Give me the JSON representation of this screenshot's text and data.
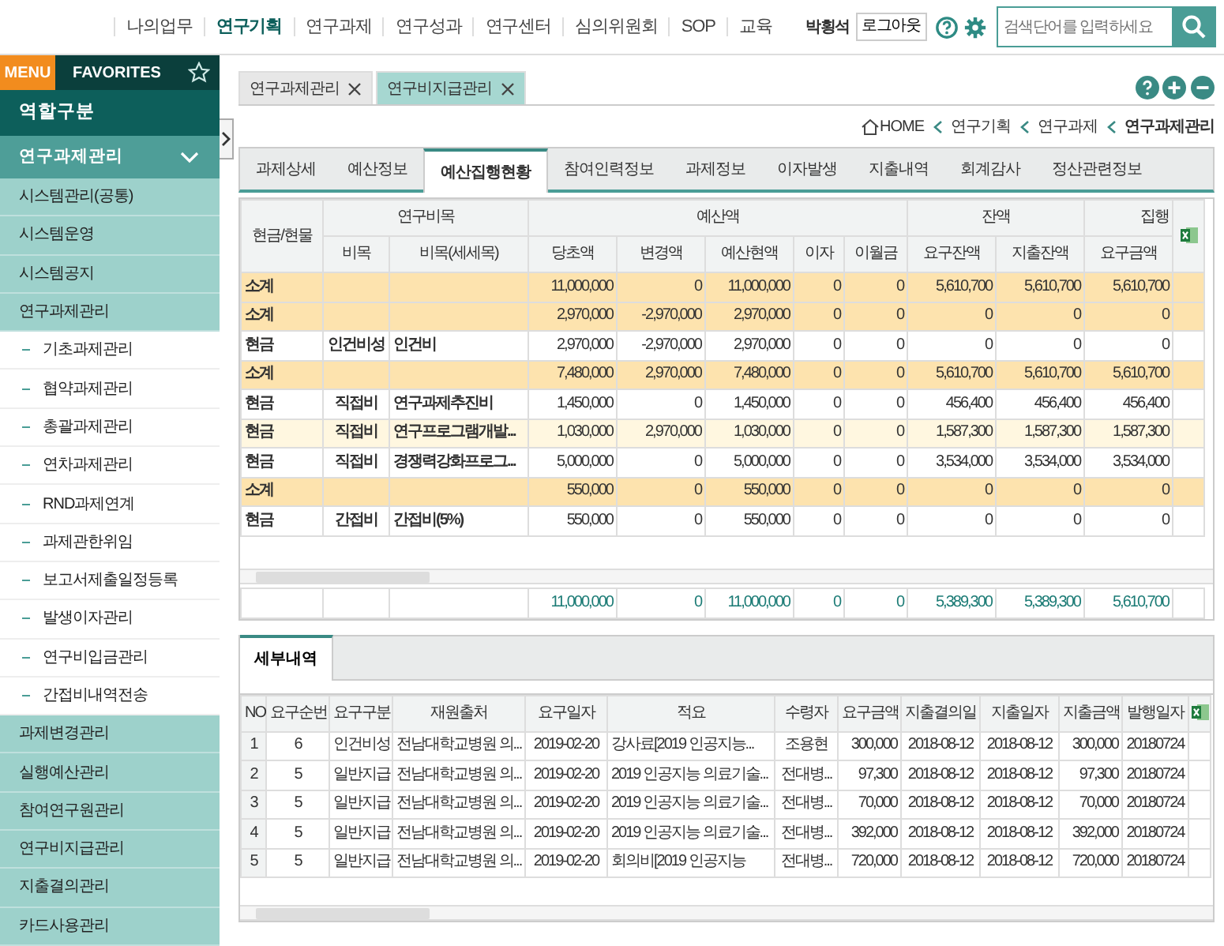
{
  "top_nav": {
    "items": [
      {
        "label": "나의업무",
        "selected": false
      },
      {
        "label": "연구기획",
        "selected": true
      },
      {
        "label": "연구과제",
        "selected": false
      },
      {
        "label": "연구성과",
        "selected": false
      },
      {
        "label": "연구센터",
        "selected": false
      },
      {
        "label": "심의위원회",
        "selected": false
      },
      {
        "label": "SOP",
        "selected": false
      },
      {
        "label": "교육",
        "selected": false
      }
    ],
    "user": "박횡석",
    "logout": "로그아웃",
    "search": {
      "placeholder": "검색단어를 입력하세요"
    }
  },
  "sidebar": {
    "tabs": [
      {
        "label": "MENU",
        "selected": true
      },
      {
        "label": "FAVORITES",
        "selected": false
      }
    ],
    "role": "역할구분",
    "section": {
      "label": "연구과제관리",
      "expanded": true
    },
    "items": [
      {
        "label": "시스템관리(공통)",
        "kind": "group"
      },
      {
        "label": "시스템운영",
        "kind": "group"
      },
      {
        "label": "시스템공지",
        "kind": "group"
      },
      {
        "label": "연구과제관리",
        "kind": "group"
      },
      {
        "label": "기초과제관리",
        "kind": "sub"
      },
      {
        "label": "협약과제관리",
        "kind": "sub"
      },
      {
        "label": "총괄과제관리",
        "kind": "sub"
      },
      {
        "label": "연차과제관리",
        "kind": "sub"
      },
      {
        "label": "RND과제연계",
        "kind": "sub"
      },
      {
        "label": "과제관한위임",
        "kind": "sub"
      },
      {
        "label": "보고서제출일정등록",
        "kind": "sub"
      },
      {
        "label": "발생이자관리",
        "kind": "sub"
      },
      {
        "label": "연구비입금관리",
        "kind": "sub"
      },
      {
        "label": "간접비내역전송",
        "kind": "sub"
      },
      {
        "label": "과제변경관리",
        "kind": "group"
      },
      {
        "label": "실행예산관리",
        "kind": "group"
      },
      {
        "label": "참여연구원관리",
        "kind": "group"
      },
      {
        "label": "연구비지급관리",
        "kind": "group"
      },
      {
        "label": "지출결의관리",
        "kind": "group"
      },
      {
        "label": "카드사용관리",
        "kind": "group"
      }
    ]
  },
  "open_tabs": [
    {
      "label": "연구과제관리",
      "selected": false
    },
    {
      "label": "연구비지급관리",
      "selected": true
    }
  ],
  "breadcrumb": [
    "HOME",
    "연구기획",
    "연구과제",
    "연구과제관리"
  ],
  "detail_tabs": [
    {
      "label": "과제상세",
      "selected": false
    },
    {
      "label": "예산정보",
      "selected": false
    },
    {
      "label": "예산집행현황",
      "selected": true
    },
    {
      "label": "참여인력정보",
      "selected": false
    },
    {
      "label": "과제정보",
      "selected": false
    },
    {
      "label": "이자발생",
      "selected": false
    },
    {
      "label": "지출내역",
      "selected": false
    },
    {
      "label": "회계감사",
      "selected": false
    },
    {
      "label": "정산관련정보",
      "selected": false
    }
  ],
  "budget_table": {
    "first_column": "현금/현물",
    "column_groups": [
      {
        "label": "연구비목",
        "columns": [
          "비목",
          "비목(세세목)"
        ]
      },
      {
        "label": "예산액",
        "columns": [
          "당초액",
          "변경액",
          "예산현액",
          "이자",
          "이월금"
        ]
      },
      {
        "label": "잔액",
        "columns": [
          "요구잔액",
          "지출잔액"
        ]
      },
      {
        "label": "집행",
        "columns": [
          "요구금액"
        ]
      }
    ],
    "rows": [
      {
        "kind": "subtotal",
        "selected": false,
        "cells": [
          "소계",
          "",
          "",
          "11,000,000",
          "0",
          "11,000,000",
          "0",
          "0",
          "5,610,700",
          "5,610,700",
          "5,610,700"
        ]
      },
      {
        "kind": "subtotal",
        "selected": false,
        "cells": [
          "소계",
          "",
          "",
          "2,970,000",
          "-2,970,000",
          "2,970,000",
          "0",
          "0",
          "0",
          "0",
          "0"
        ]
      },
      {
        "kind": "item",
        "selected": false,
        "cells": [
          "현금",
          "인건비성",
          "인건비",
          "2,970,000",
          "-2,970,000",
          "2,970,000",
          "0",
          "0",
          "0",
          "0",
          "0"
        ]
      },
      {
        "kind": "subtotal",
        "selected": false,
        "cells": [
          "소계",
          "",
          "",
          "7,480,000",
          "2,970,000",
          "7,480,000",
          "0",
          "0",
          "5,610,700",
          "5,610,700",
          "5,610,700"
        ]
      },
      {
        "kind": "item",
        "selected": false,
        "cells": [
          "현금",
          "직접비",
          "연구과제추진비",
          "1,450,000",
          "0",
          "1,450,000",
          "0",
          "0",
          "456,400",
          "456,400",
          "456,400"
        ]
      },
      {
        "kind": "item",
        "selected": true,
        "cells": [
          "현금",
          "직접비",
          "연구프로그램개발...",
          "1,030,000",
          "2,970,000",
          "1,030,000",
          "0",
          "0",
          "1,587,300",
          "1,587,300",
          "1,587,300"
        ]
      },
      {
        "kind": "item",
        "selected": false,
        "cells": [
          "현금",
          "직접비",
          "경쟁력강화프로그...",
          "5,000,000",
          "0",
          "5,000,000",
          "0",
          "0",
          "3,534,000",
          "3,534,000",
          "3,534,000"
        ]
      },
      {
        "kind": "subtotal",
        "selected": false,
        "cells": [
          "소계",
          "",
          "",
          "550,000",
          "0",
          "550,000",
          "0",
          "0",
          "0",
          "0",
          "0"
        ]
      },
      {
        "kind": "item",
        "selected": false,
        "cells": [
          "현금",
          "간접비",
          "간접비(5%)",
          "550,000",
          "0",
          "550,000",
          "0",
          "0",
          "0",
          "0",
          "0"
        ]
      }
    ],
    "totals": [
      "11,000,000",
      "0",
      "11,000,000",
      "0",
      "0",
      "5,389,300",
      "5,389,300",
      "5,610,700"
    ]
  },
  "detail_section": {
    "tab": "세부내역",
    "columns": [
      "NO",
      "요구순번",
      "요구구분",
      "재원출처",
      "요구일자",
      "적요",
      "수령자",
      "요구금액",
      "지출결의일",
      "지출일자",
      "지출금액",
      "발행일자"
    ],
    "rows": [
      [
        "1",
        "6",
        "인건비성",
        "전남대학교병원 의...",
        "2019-02-20",
        "강사료[2019 인공지능...",
        "조용현",
        "300,000",
        "2018-08-12",
        "2018-08-12",
        "300,000",
        "20180724"
      ],
      [
        "2",
        "5",
        "일반지급",
        "전남대학교병원 의...",
        "2019-02-20",
        "2019 인공지능 의료기술...",
        "전대병...",
        "97,300",
        "2018-08-12",
        "2018-08-12",
        "97,300",
        "20180724"
      ],
      [
        "3",
        "5",
        "일반지급",
        "전남대학교병원 의...",
        "2019-02-20",
        "2019 인공지능 의료기술...",
        "전대병...",
        "70,000",
        "2018-08-12",
        "2018-08-12",
        "70,000",
        "20180724"
      ],
      [
        "4",
        "5",
        "일반지급",
        "전남대학교병원 의...",
        "2019-02-20",
        "2019 인공지능 의료기술...",
        "전대병...",
        "392,000",
        "2018-08-12",
        "2018-08-12",
        "392,000",
        "20180724"
      ],
      [
        "5",
        "5",
        "일반지급",
        "전남대학교병원 의...",
        "2019-02-20",
        "회의비[2019 인공지능",
        "전대병...",
        "720,000",
        "2018-08-12",
        "2018-08-12",
        "720,000",
        "20180724"
      ]
    ]
  }
}
